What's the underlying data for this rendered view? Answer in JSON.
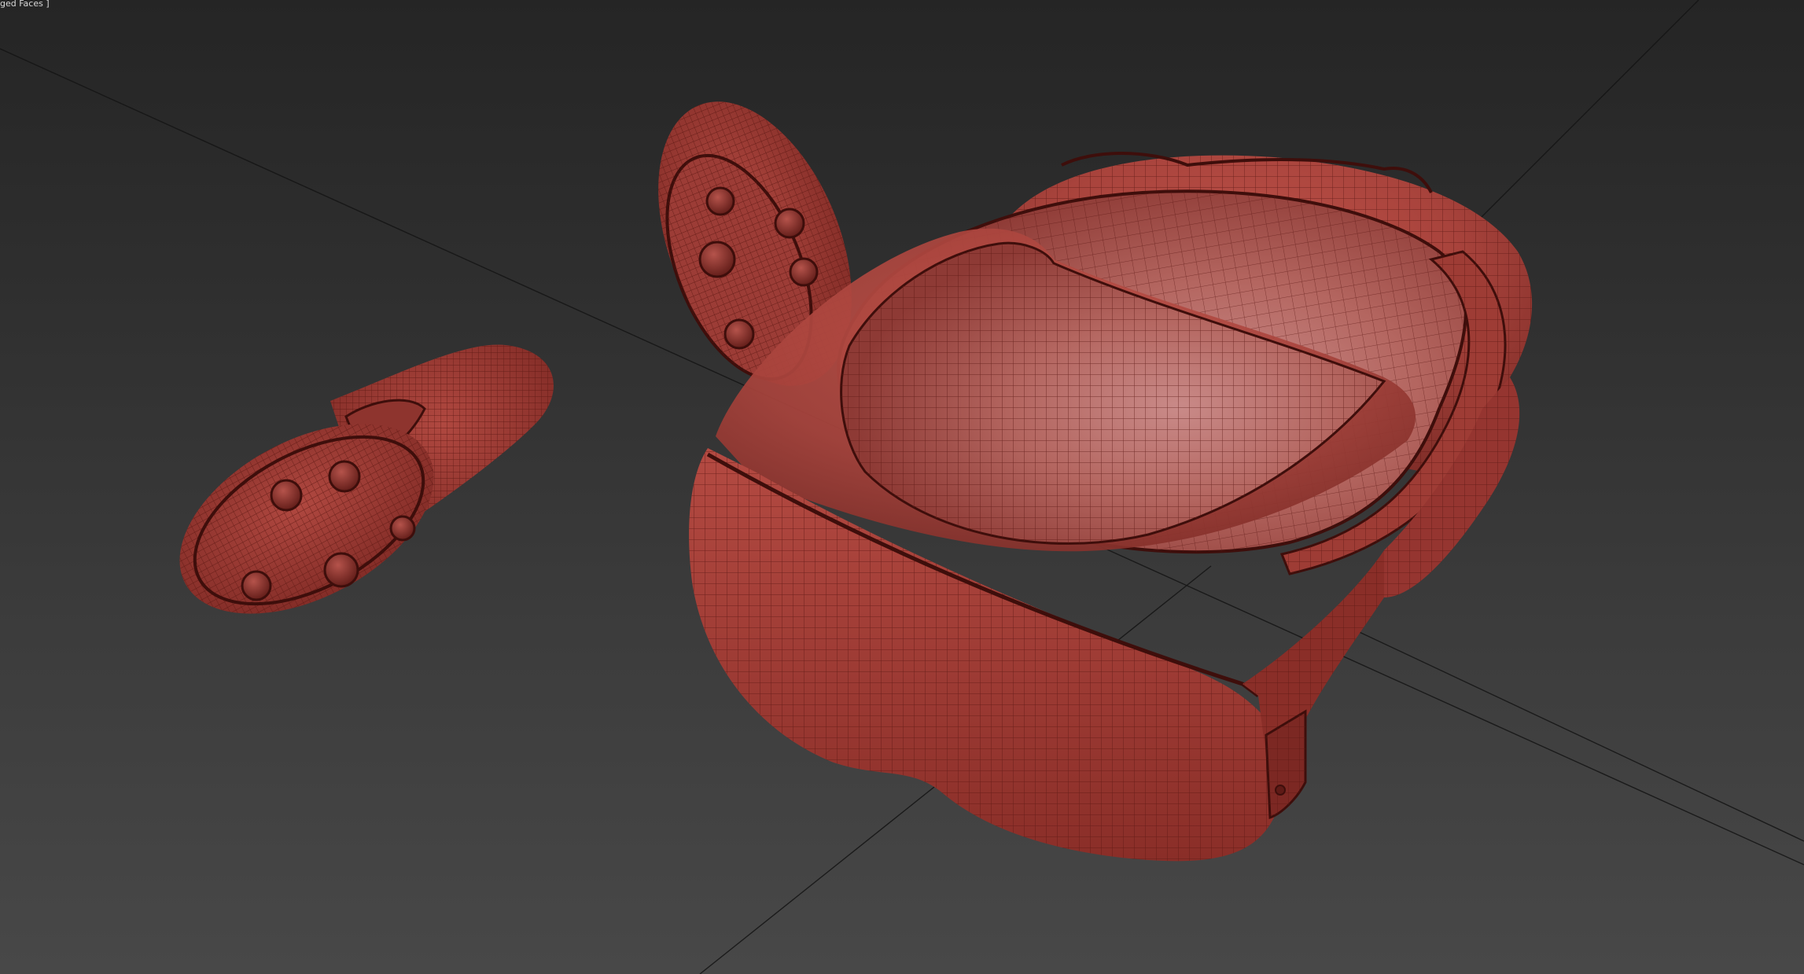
{
  "viewport": {
    "shading_label": "ged Faces ]",
    "background_color": "#3a3a3a",
    "grid_line_color": "#141414"
  },
  "scene": {
    "objects": [
      {
        "name": "vr-headset",
        "color": "#a8433c"
      },
      {
        "name": "controller-left",
        "color": "#a8433c"
      },
      {
        "name": "controller-right",
        "color": "#a8433c"
      }
    ],
    "wireframe_color": "#5a1612",
    "highlight_color": "#c87a78"
  }
}
